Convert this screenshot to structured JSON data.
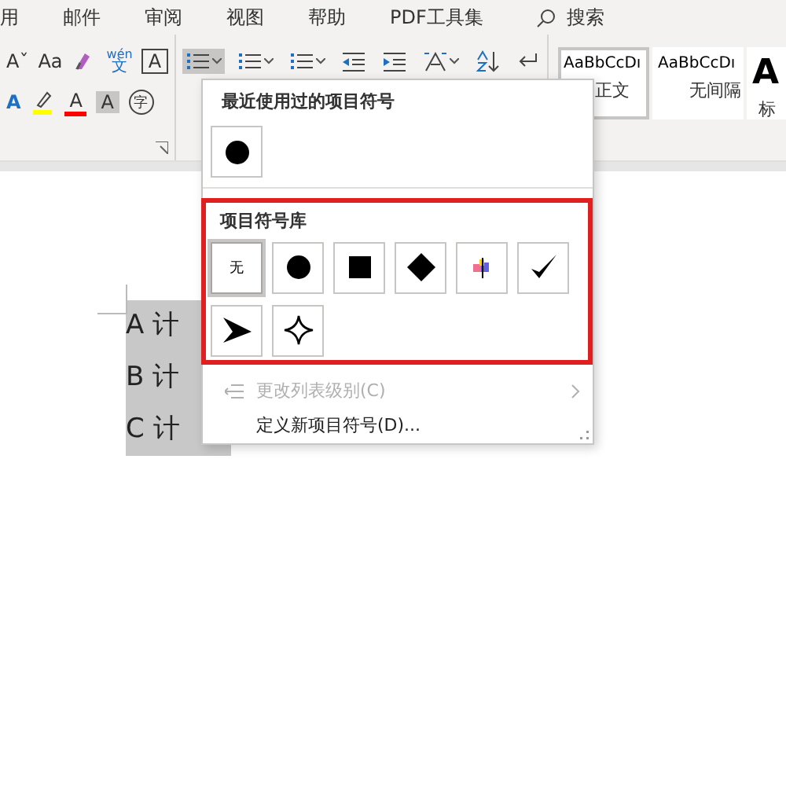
{
  "tabs": [
    {
      "label": "用"
    },
    {
      "label": "邮件"
    },
    {
      "label": "审阅"
    },
    {
      "label": "视图"
    },
    {
      "label": "帮助"
    },
    {
      "label": "PDF工具集"
    }
  ],
  "search": {
    "label": "搜索"
  },
  "ribbon": {
    "font_tools": [
      {
        "kind": "text",
        "text": "Aˇ"
      },
      {
        "kind": "text",
        "text": "Aa"
      },
      {
        "kind": "clear"
      },
      {
        "kind": "phonetic",
        "text": "文",
        "ruby": "wén"
      },
      {
        "kind": "boxed",
        "text": "A"
      }
    ],
    "font_tools_2": [
      {
        "kind": "fontfx",
        "text": "A"
      },
      {
        "kind": "highlight",
        "color": "#ffff00"
      },
      {
        "kind": "fontcolor",
        "text": "A",
        "color": "#ff0000"
      },
      {
        "kind": "shaded",
        "text": "A"
      },
      {
        "kind": "circled",
        "text": "字"
      }
    ],
    "paragraph_tools": [
      {
        "kind": "bullets",
        "selected": true
      },
      {
        "kind": "numbering",
        "selected": false
      },
      {
        "kind": "multilevel",
        "selected": false
      },
      {
        "kind": "outdent",
        "selected": false
      },
      {
        "kind": "indent",
        "selected": false
      },
      {
        "kind": "spacing",
        "selected": false
      },
      {
        "kind": "sort",
        "selected": false
      },
      {
        "kind": "marks",
        "selected": false
      }
    ],
    "styles": [
      {
        "preview": "AaBbCcDı",
        "label": "正文",
        "selected": true
      },
      {
        "preview": "AaBbCcDı",
        "label": "无间隔",
        "selected": false
      },
      {
        "preview": "A",
        "label": "标",
        "selected": false
      }
    ]
  },
  "document": {
    "lines": [
      "A 计",
      "B 计",
      "C 计"
    ]
  },
  "bullet_menu": {
    "recent_header": "最近使用过的项目符号",
    "recent": [
      {
        "kind": "circle"
      }
    ],
    "library_header": "项目符号库",
    "library_highlighted": true,
    "library": [
      {
        "kind": "none",
        "text": "无",
        "selected": true
      },
      {
        "kind": "circle",
        "selected": false
      },
      {
        "kind": "square",
        "selected": false
      },
      {
        "kind": "diamond",
        "selected": false
      },
      {
        "kind": "picture",
        "selected": false
      },
      {
        "kind": "check",
        "selected": false
      },
      {
        "kind": "arrowhead",
        "selected": false
      },
      {
        "kind": "star",
        "selected": false
      }
    ],
    "items": [
      {
        "kind": "level",
        "label": "更改列表级别(C)",
        "disabled": true
      },
      {
        "kind": "define",
        "label": "定义新项目符号(D)...",
        "disabled": false
      }
    ]
  }
}
